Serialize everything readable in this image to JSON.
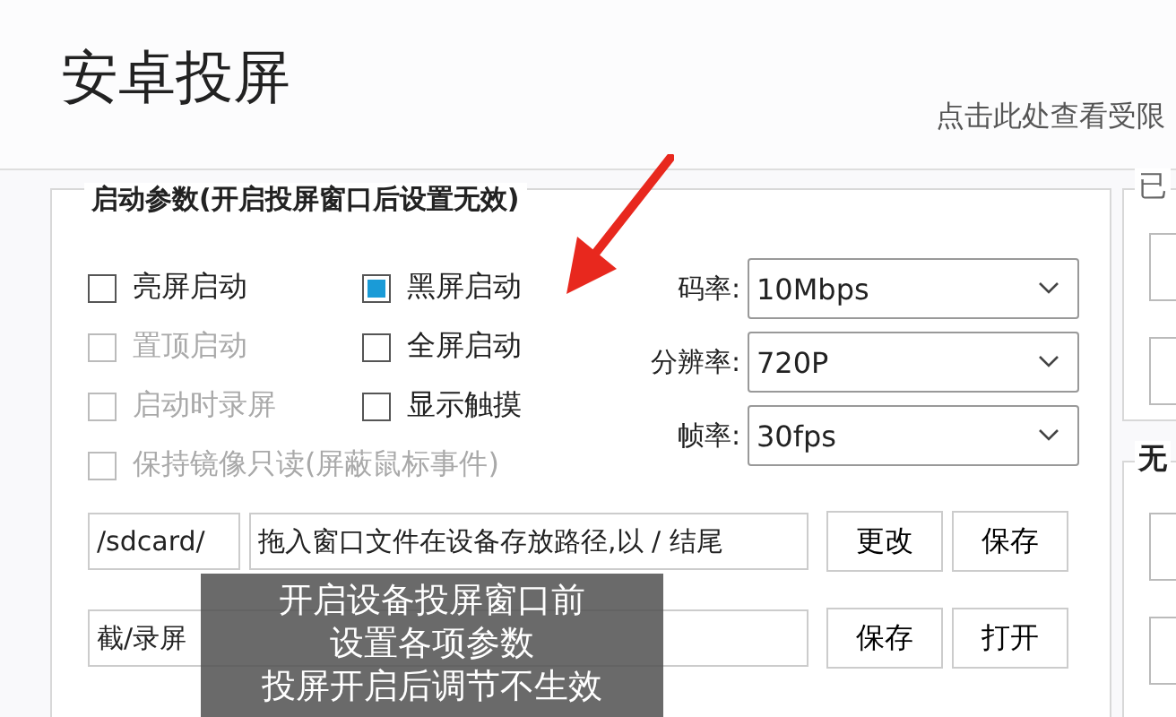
{
  "window": {
    "title": "安卓投屏"
  },
  "restriction_link": "点击此处查看受限",
  "launch_group": {
    "title": "启动参数(开启投屏窗口后设置无效)",
    "checkboxes": [
      {
        "label": "亮屏启动",
        "checked": false,
        "disabled": false
      },
      {
        "label": "黑屏启动",
        "checked": true,
        "disabled": false
      },
      {
        "label": "置顶启动",
        "checked": false,
        "disabled": true
      },
      {
        "label": "全屏启动",
        "checked": false,
        "disabled": false
      },
      {
        "label": "启动时录屏",
        "checked": false,
        "disabled": true
      },
      {
        "label": "显示触摸",
        "checked": false,
        "disabled": false
      },
      {
        "label": "保持镜像只读(屏蔽鼠标事件)",
        "checked": false,
        "disabled": true
      }
    ],
    "dropdowns": [
      {
        "label": "码率:",
        "value": "10Mbps"
      },
      {
        "label": "分辨率:",
        "value": "720P"
      },
      {
        "label": "帧率:",
        "value": "30fps"
      }
    ],
    "push_row": {
      "prefix": "/sdcard/",
      "value": "拖入窗口文件在设备存放路径,以 / 结尾",
      "buttons": [
        "更改",
        "保存"
      ]
    },
    "save_row": {
      "value_start": "截/录屏",
      "buttons": [
        "保存",
        "打开"
      ]
    }
  },
  "side_groups": [
    {
      "title": "已",
      "bold": false
    },
    {
      "title": "无",
      "bold": true
    }
  ],
  "caption": [
    "开启设备投屏窗口前",
    "设置各项参数",
    "投屏开启后调节不生效"
  ]
}
